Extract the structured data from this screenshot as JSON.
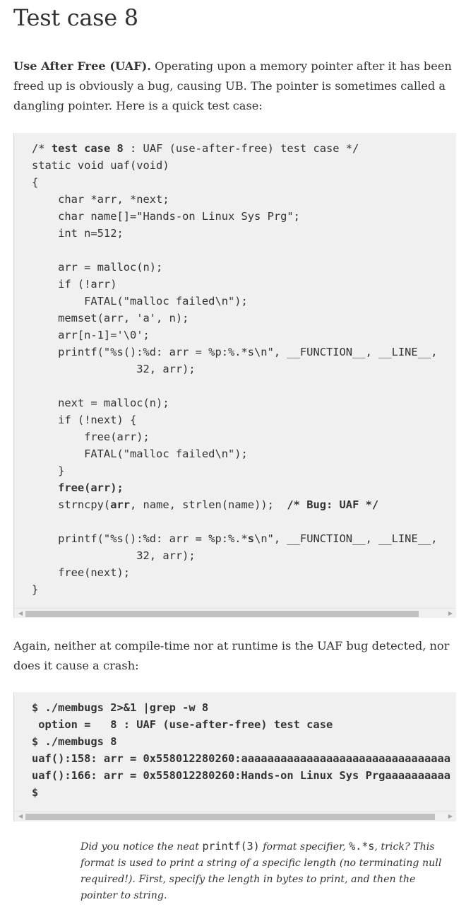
{
  "title": "Test case 8",
  "intro": {
    "term": "Use After Free (UAF).",
    "text": " Operating upon a memory pointer after it has been freed up is obviously a bug, causing UB. The pointer is sometimes called a dangling pointer. Here is a quick test case:"
  },
  "code1": {
    "lines": [
      [
        {
          "t": "/* "
        },
        {
          "t": "test case 8",
          "b": true
        },
        {
          "t": " : UAF (use-after-free) test case */"
        }
      ],
      [
        {
          "t": "static void uaf(void)"
        }
      ],
      [
        {
          "t": "{"
        }
      ],
      [
        {
          "t": "    char *arr, *next;"
        }
      ],
      [
        {
          "t": "    char name[]=\"Hands-on Linux Sys Prg\";"
        }
      ],
      [
        {
          "t": "    int n=512;"
        }
      ],
      [
        {
          "t": ""
        }
      ],
      [
        {
          "t": "    arr = malloc(n);"
        }
      ],
      [
        {
          "t": "    if (!arr)"
        }
      ],
      [
        {
          "t": "        FATAL(\"malloc failed\\n\");"
        }
      ],
      [
        {
          "t": "    memset(arr, 'a', n);"
        }
      ],
      [
        {
          "t": "    arr[n-1]='\\0';"
        }
      ],
      [
        {
          "t": "    printf(\"%s():%d: arr = %p:%.*s\\n\", __FUNCTION__, __LINE__,"
        }
      ],
      [
        {
          "t": "                32, arr);"
        }
      ],
      [
        {
          "t": ""
        }
      ],
      [
        {
          "t": "    next = malloc(n);"
        }
      ],
      [
        {
          "t": "    if (!next) {"
        }
      ],
      [
        {
          "t": "        free(arr);"
        }
      ],
      [
        {
          "t": "        FATAL(\"malloc failed\\n\");"
        }
      ],
      [
        {
          "t": "    }"
        }
      ],
      [
        {
          "t": "    "
        },
        {
          "t": "free(arr);",
          "b": true
        }
      ],
      [
        {
          "t": "    strncpy("
        },
        {
          "t": "arr",
          "b": true
        },
        {
          "t": ", name, strlen(name));  "
        },
        {
          "t": "/* Bug: UAF */",
          "b": true
        }
      ],
      [
        {
          "t": ""
        }
      ],
      [
        {
          "t": "    printf(\"%s():%d: arr = %p:%.*"
        },
        {
          "t": "s",
          "b": true
        },
        {
          "t": "\\n\", __FUNCTION__, __LINE__,"
        }
      ],
      [
        {
          "t": "                32, arr);"
        }
      ],
      [
        {
          "t": "    free(next);"
        }
      ],
      [
        {
          "t": "}"
        }
      ]
    ]
  },
  "middle_text": "Again, neither at compile-time nor at runtime is the UAF bug detected, nor does it cause a crash:",
  "code2": {
    "lines": [
      [
        {
          "t": "$ ./membugs 2>&1 |grep -w 8",
          "b": true
        }
      ],
      [
        {
          "t": " option =   8 : UAF (use-after-free) test case",
          "b": true
        }
      ],
      [
        {
          "t": "$ ./membugs 8",
          "b": true
        }
      ],
      [
        {
          "t": "uaf():158: arr = 0x558012280260:aaaaaaaaaaaaaaaaaaaaaaaaaaaaaaaa",
          "b": true
        }
      ],
      [
        {
          "t": "uaf():166: arr = 0x558012280260:Hands-on Linux Sys Prgaaaaaaaaaa",
          "b": true
        }
      ],
      [
        {
          "t": "$",
          "b": true
        }
      ]
    ]
  },
  "note": {
    "before": "Did you notice the neat ",
    "code_a": "printf(3)",
    "middle": " format specifier, ",
    "code_b": "%.*s",
    "after": ", trick? This format is used to print a string of a specific length (no terminating null required!). First, specify the length in bytes to print, and then the pointer to string."
  },
  "scrollbar_arrows": {
    "left": "◀",
    "right": "▶"
  }
}
